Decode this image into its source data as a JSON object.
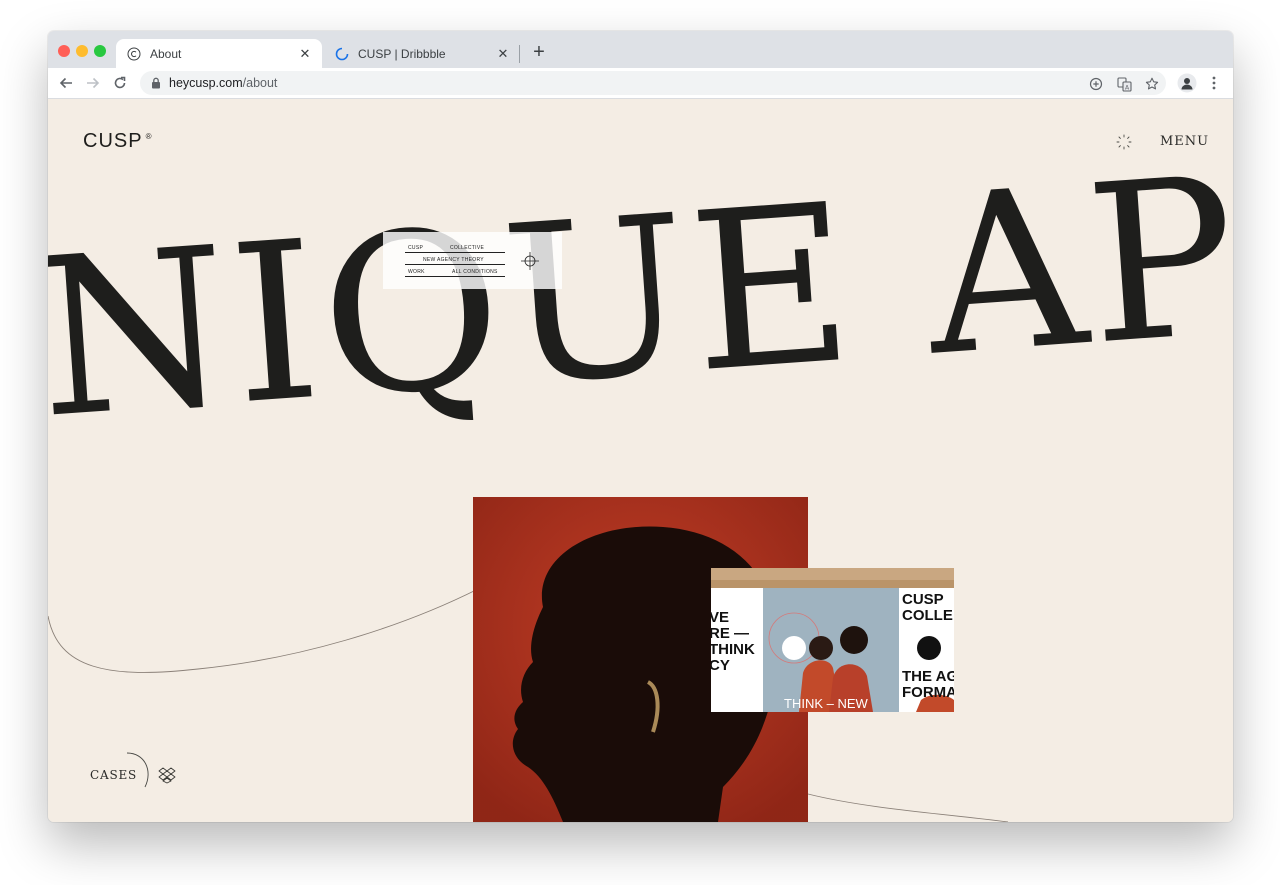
{
  "browser": {
    "tabs": [
      {
        "title": "About",
        "favicon": "copyright-icon",
        "active": true
      },
      {
        "title": "CUSP | Dribbble",
        "favicon": "loading-spinner-icon",
        "active": false
      }
    ],
    "address": {
      "domain": "heycusp.com",
      "path": "/about"
    }
  },
  "site": {
    "logo": "CUSP",
    "logo_mark": "®",
    "menu_label": "MENU",
    "hero_text": "NIQUE APP",
    "info_card": {
      "rows": [
        {
          "left": "CUSP",
          "right": "COLLECTIVE"
        },
        {
          "center": "NEW AGENCY THEORY"
        },
        {
          "left": "WORK",
          "right": "ALL CONDITIONS"
        }
      ]
    },
    "preview": {
      "left_lines": "VE\nRE —\nTHINK\nCY",
      "right_top": "CUSP\nCOLLE",
      "right_bottom": "THE AG\nFORMA",
      "caption": "THINK – NEW"
    },
    "cases_label": "CASES"
  },
  "colors": {
    "page_bg": "#f4ede4",
    "ink": "#1e1e1c",
    "portrait_red": "#b8341f",
    "tab_strip": "#dee1e6"
  }
}
